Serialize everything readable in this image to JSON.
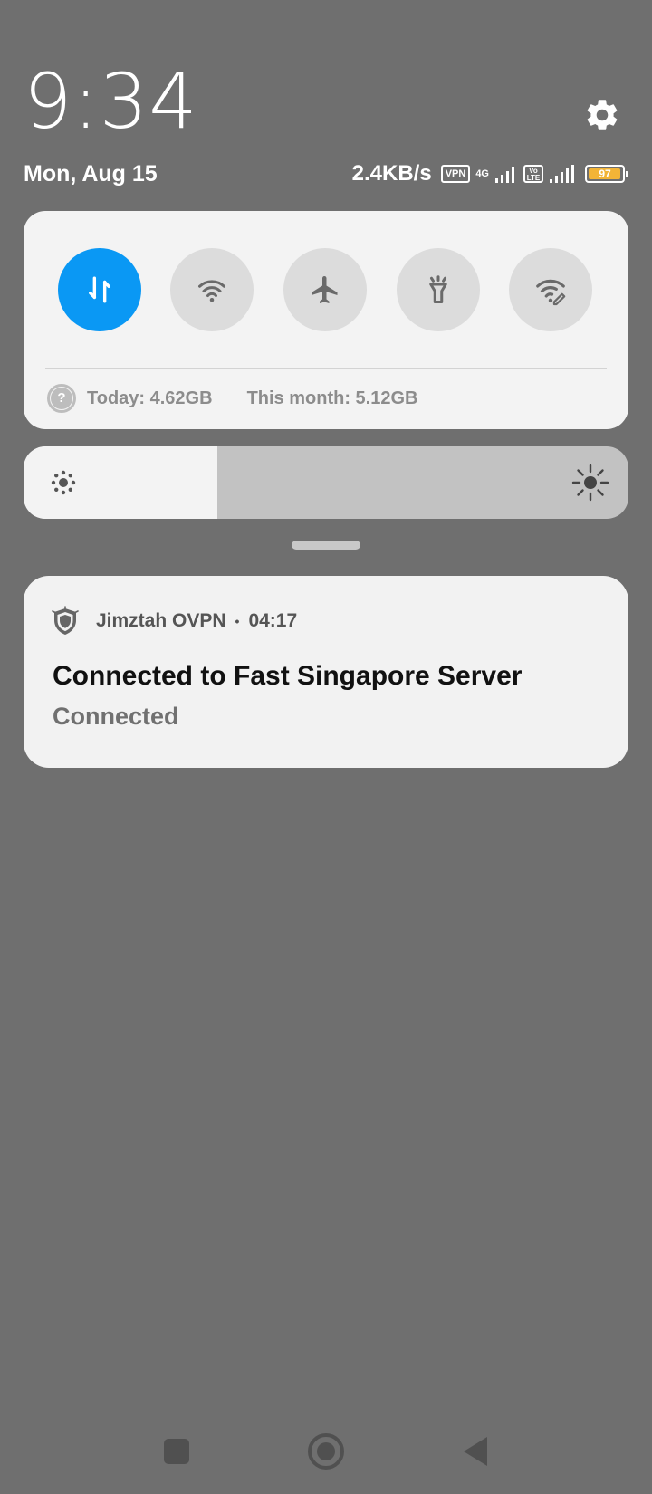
{
  "header": {
    "time": "9:34",
    "date": "Mon, Aug 15",
    "net_speed": "2.4KB/s",
    "vpn_badge": "VPN",
    "network_type": "4G",
    "volte_top": "Vo",
    "volte_bottom": "LTE",
    "battery_level": "97",
    "battery_color": "#f2b437"
  },
  "quick_settings": {
    "accent_color": "#0a98f4",
    "tiles": [
      {
        "name": "mobile-data",
        "icon": "data-transfer-icon",
        "active": true
      },
      {
        "name": "wifi",
        "icon": "wifi-icon",
        "active": false
      },
      {
        "name": "airplane-mode",
        "icon": "airplane-icon",
        "active": false
      },
      {
        "name": "flashlight",
        "icon": "flashlight-icon",
        "active": false
      },
      {
        "name": "hotspot",
        "icon": "wifi-edit-icon",
        "active": false
      }
    ],
    "usage_today": "Today: 4.62GB",
    "usage_month": "This month: 5.12GB",
    "help_glyph": "?"
  },
  "brightness": {
    "level_percent": 32
  },
  "notification": {
    "app_name": "Jimztah OVPN",
    "separator": "•",
    "time": "04:17",
    "title": "Connected to Fast Singapore Server",
    "body": "Connected"
  },
  "nav": {
    "buttons": [
      "recents-icon",
      "home-icon",
      "back-icon"
    ]
  }
}
